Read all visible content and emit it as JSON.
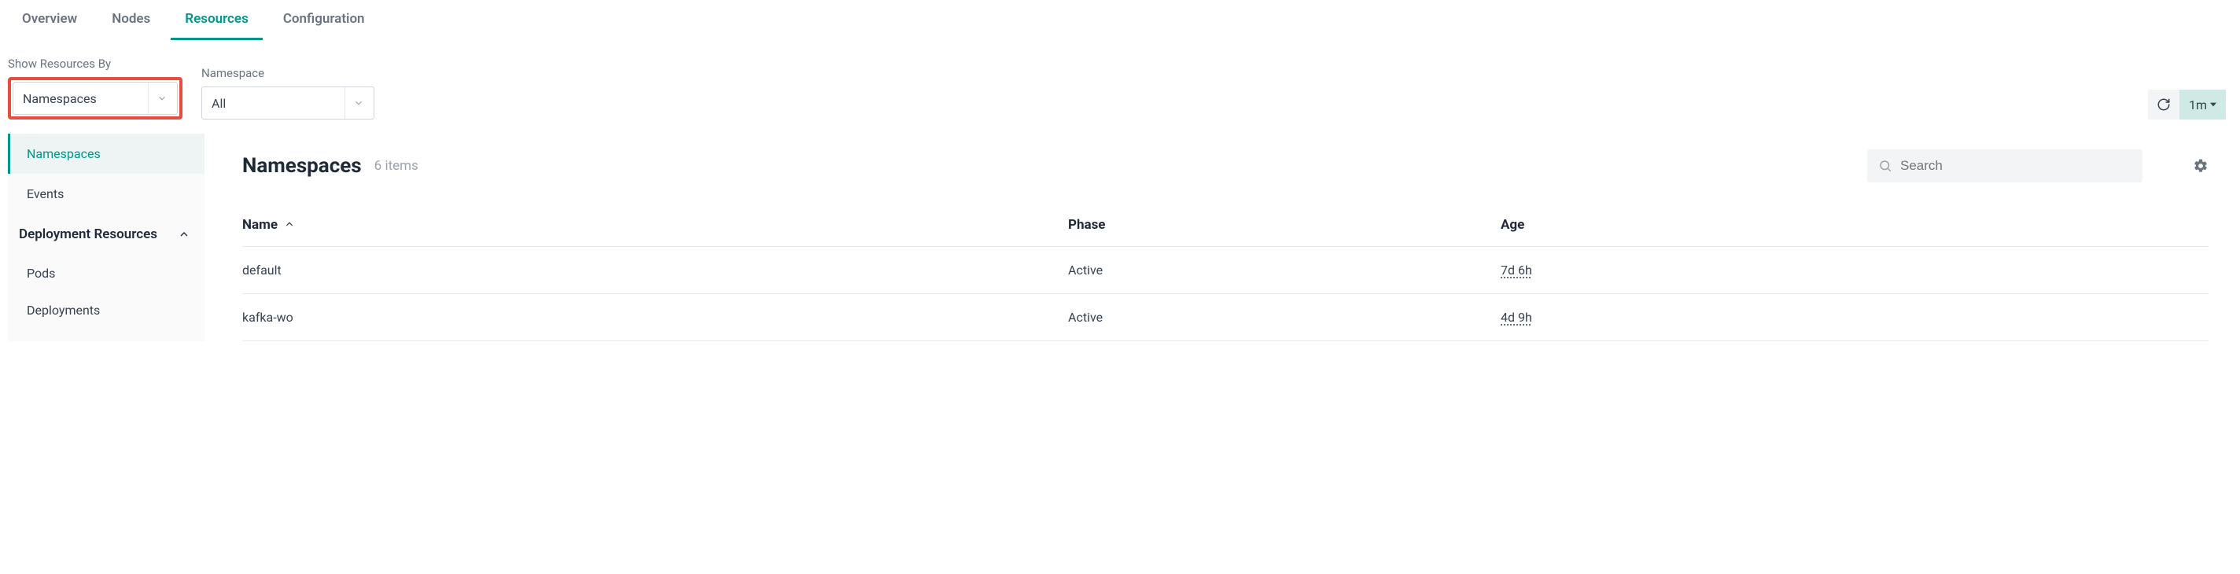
{
  "tabs": [
    {
      "label": "Overview",
      "active": false
    },
    {
      "label": "Nodes",
      "active": false
    },
    {
      "label": "Resources",
      "active": true
    },
    {
      "label": "Configuration",
      "active": false
    }
  ],
  "filters": {
    "showBy": {
      "label": "Show Resources By",
      "value": "Namespaces"
    },
    "namespace": {
      "label": "Namespace",
      "value": "All"
    }
  },
  "refresh": {
    "interval": "1m"
  },
  "sidebar": {
    "top": [
      {
        "label": "Namespaces",
        "active": true
      },
      {
        "label": "Events",
        "active": false
      }
    ],
    "group": {
      "label": "Deployment Resources"
    },
    "subs": [
      {
        "label": "Pods"
      },
      {
        "label": "Deployments"
      }
    ]
  },
  "content": {
    "title": "Namespaces",
    "count": "6 items",
    "search_placeholder": "Search"
  },
  "table": {
    "headers": {
      "name": "Name",
      "phase": "Phase",
      "age": "Age"
    },
    "rows": [
      {
        "name": "default",
        "phase": "Active",
        "age": "7d 6h"
      },
      {
        "name": "kafka-wo",
        "phase": "Active",
        "age": "4d 9h"
      }
    ]
  }
}
